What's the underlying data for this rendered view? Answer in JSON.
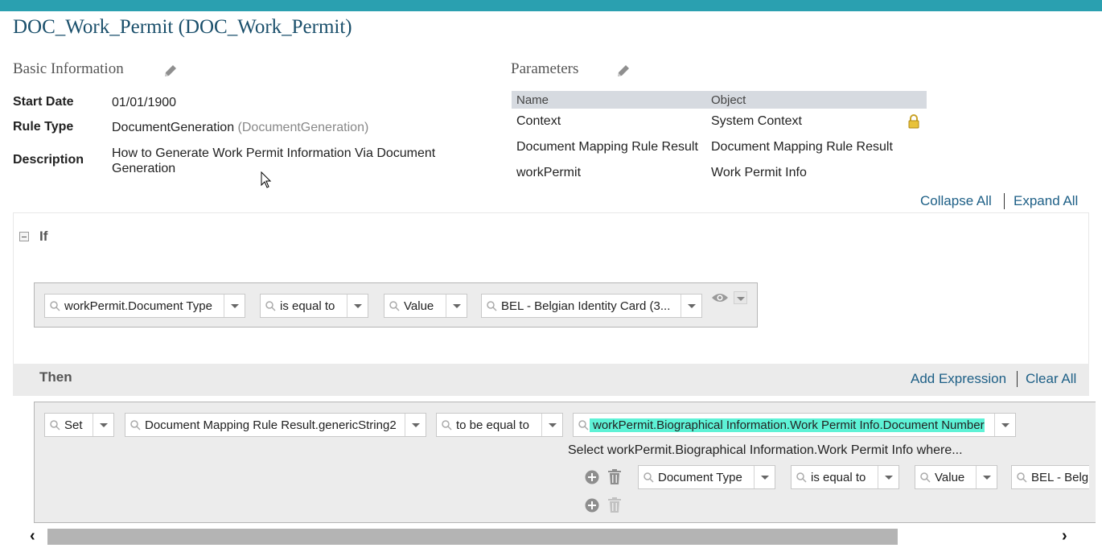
{
  "page": {
    "title": "DOC_Work_Permit (DOC_Work_Permit)"
  },
  "basic_info": {
    "heading": "Basic Information",
    "start_date_label": "Start Date",
    "start_date": "01/01/1900",
    "rule_type_label": "Rule Type",
    "rule_type": "DocumentGeneration",
    "rule_type_id": "(DocumentGeneration)",
    "description_label": "Description",
    "description_line1": "How to Generate Work Permit Information Via Document",
    "description_line2": "Generation"
  },
  "parameters": {
    "heading": "Parameters",
    "columns": [
      "Name",
      "Object"
    ],
    "rows": [
      {
        "name": "Context",
        "object": "System Context",
        "locked": true
      },
      {
        "name": "Document Mapping Rule Result",
        "object": "Document Mapping Rule Result"
      },
      {
        "name": "workPermit",
        "object": "Work Permit Info"
      }
    ]
  },
  "tree_links": {
    "collapse_all": "Collapse All",
    "expand_all": "Expand All"
  },
  "if_block": {
    "label": "If",
    "condition": {
      "field": "workPermit.Document Type",
      "operator": "is equal to",
      "value_type": "Value",
      "value": "BEL - Belgian Identity Card (3..."
    }
  },
  "then_block": {
    "label": "Then",
    "add_expression": "Add Expression",
    "clear_all": "Clear All",
    "action": {
      "verb": "Set",
      "target": "Document Mapping Rule Result.genericString2",
      "operator": "to be equal to",
      "source": "workPermit.Biographical Information.Work Permit Info.Document Number"
    },
    "select_text": "Select workPermit.Biographical Information.Work Permit Info where...",
    "sub_condition": {
      "field": "Document Type",
      "operator": "is equal to",
      "value_type": "Value",
      "value": "BEL - Belgi"
    }
  },
  "colors": {
    "accent": "#2aa0b0",
    "link": "#1d5f86",
    "highlight": "#5ef2d6"
  },
  "icons": [
    "pencil-icon",
    "lock-icon",
    "search-icon",
    "eye-icon",
    "add-icon",
    "trash-icon"
  ]
}
